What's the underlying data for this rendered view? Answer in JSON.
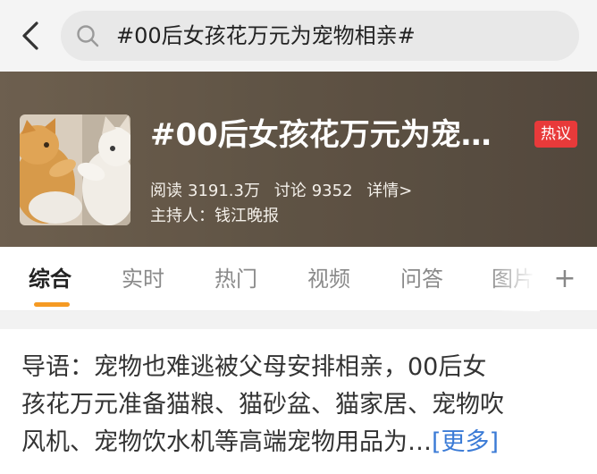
{
  "search": {
    "query": "#00后女孩花万元为宠物相亲#"
  },
  "hero": {
    "title": "#00后女孩花万元为宠…",
    "badge": "热议",
    "reads_label": "阅读",
    "reads_value": "3191.3万",
    "discuss_label": "讨论",
    "discuss_value": "9352",
    "details_link": "详情>",
    "host_label": "主持人：",
    "host_name": "钱江晚报",
    "colors": {
      "badge": "#e83a3a"
    }
  },
  "tabs": [
    {
      "label": "综合",
      "active": true
    },
    {
      "label": "实时",
      "active": false
    },
    {
      "label": "热门",
      "active": false
    },
    {
      "label": "视频",
      "active": false
    },
    {
      "label": "问答",
      "active": false
    },
    {
      "label": "图片",
      "active": false
    }
  ],
  "tab_add_label": "+",
  "accent_color": "#f59a23",
  "intro": {
    "line1": "导语：宠物也难逃被父母安排相亲，00后女",
    "line2": "孩花万元准备猫粮、猫砂盆、猫家居、宠物吹",
    "line3": "风机、宠物饮水机等高端宠物用品为…",
    "more": "[更多]"
  },
  "icons": {
    "back": "chevron-left-icon",
    "search": "search-icon",
    "add": "plus-icon"
  }
}
